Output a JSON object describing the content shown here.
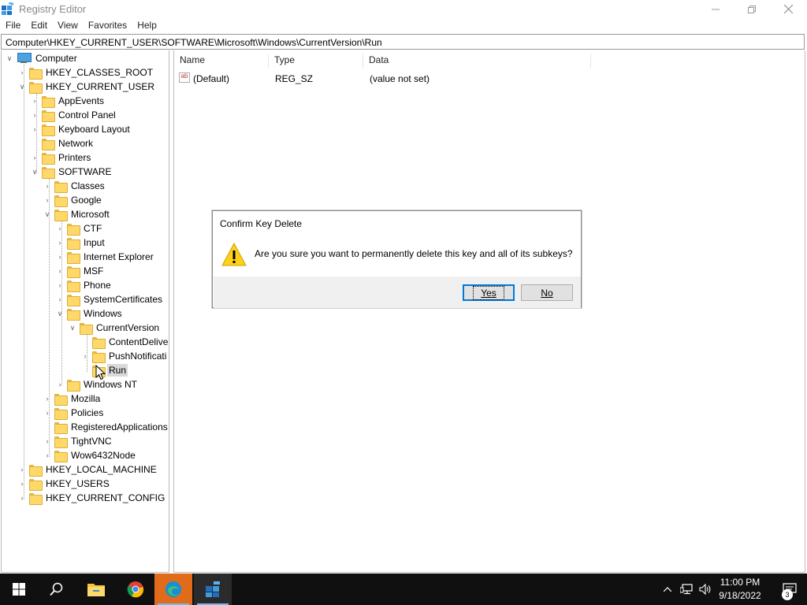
{
  "window": {
    "title": "Registry Editor",
    "controls": {
      "minimize": "—",
      "maximize": "❐",
      "close": "✕"
    }
  },
  "menu": [
    "File",
    "Edit",
    "View",
    "Favorites",
    "Help"
  ],
  "address": "Computer\\HKEY_CURRENT_USER\\SOFTWARE\\Microsoft\\Windows\\CurrentVersion\\Run",
  "tree": {
    "root": "Computer",
    "nodes": [
      {
        "label": "HKEY_CLASSES_ROOT",
        "state": "collapsed"
      },
      {
        "label": "HKEY_CURRENT_USER",
        "state": "expanded"
      },
      {
        "label": "AppEvents",
        "state": "collapsed"
      },
      {
        "label": "Control Panel",
        "state": "collapsed"
      },
      {
        "label": "Keyboard Layout",
        "state": "collapsed"
      },
      {
        "label": "Network",
        "state": "leaf"
      },
      {
        "label": "Printers",
        "state": "collapsed"
      },
      {
        "label": "SOFTWARE",
        "state": "expanded"
      },
      {
        "label": "Classes",
        "state": "collapsed"
      },
      {
        "label": "Google",
        "state": "collapsed"
      },
      {
        "label": "Microsoft",
        "state": "expanded"
      },
      {
        "label": "CTF",
        "state": "collapsed"
      },
      {
        "label": "Input",
        "state": "collapsed"
      },
      {
        "label": "Internet Explorer",
        "state": "collapsed"
      },
      {
        "label": "MSF",
        "state": "collapsed"
      },
      {
        "label": "Phone",
        "state": "collapsed"
      },
      {
        "label": "SystemCertificates",
        "state": "collapsed"
      },
      {
        "label": "Windows",
        "state": "expanded"
      },
      {
        "label": "CurrentVersion",
        "state": "expanded"
      },
      {
        "label": "ContentDelive",
        "state": "leaf"
      },
      {
        "label": "PushNotificati",
        "state": "collapsed"
      },
      {
        "label": "Run",
        "state": "leaf",
        "selected": true
      },
      {
        "label": "Windows NT",
        "state": "collapsed"
      },
      {
        "label": "Mozilla",
        "state": "collapsed"
      },
      {
        "label": "Policies",
        "state": "collapsed"
      },
      {
        "label": "RegisteredApplications",
        "state": "leaf"
      },
      {
        "label": "TightVNC",
        "state": "collapsed"
      },
      {
        "label": "Wow6432Node",
        "state": "collapsed"
      },
      {
        "label": "HKEY_LOCAL_MACHINE",
        "state": "collapsed"
      },
      {
        "label": "HKEY_USERS",
        "state": "collapsed"
      },
      {
        "label": "HKEY_CURRENT_CONFIG",
        "state": "collapsed"
      }
    ]
  },
  "list": {
    "columns": [
      "Name",
      "Type",
      "Data"
    ],
    "rows": [
      {
        "name": "(Default)",
        "type": "REG_SZ",
        "data": "(value not set)"
      }
    ]
  },
  "dialog": {
    "title": "Confirm Key Delete",
    "message": "Are you sure you want to permanently delete this key and all of its subkeys?",
    "yes_label": "Yes",
    "no_label": "No"
  },
  "taskbar": {
    "apps": [
      "start-icon",
      "search-icon",
      "file-explorer-icon",
      "chrome-icon",
      "edge-icon",
      "registry-editor-icon"
    ],
    "time": "11:00 PM",
    "date": "9/18/2022",
    "notification_count": "3"
  }
}
